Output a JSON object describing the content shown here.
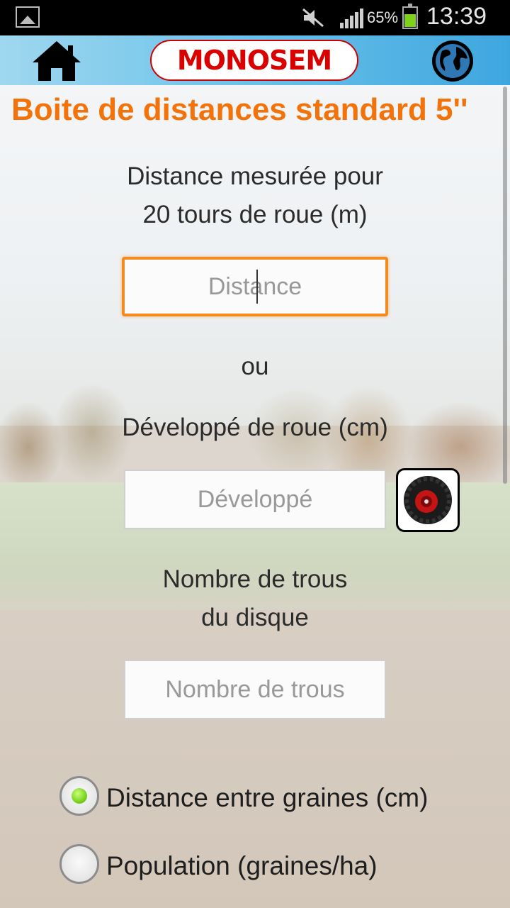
{
  "status_bar": {
    "battery_percent": "65%",
    "time": "13:39",
    "battery_level": 0.65,
    "icons": [
      "gallery-icon",
      "mute-icon",
      "signal-icon",
      "battery-icon"
    ]
  },
  "app_bar": {
    "logo_text": "MONOSEM",
    "home_icon": "home-icon",
    "globe_icon": "globe-icon",
    "brand_color": "#d90000"
  },
  "page": {
    "title": "Boite de distances standard 5''",
    "title_color": "#f3730b",
    "distance_label_line1": "Distance mesurée pour",
    "distance_label_line2": "20 tours de roue (m)",
    "distance_placeholder": "Distance",
    "or_label": "ou",
    "wheel_label": "Développé de roue (cm)",
    "wheel_placeholder": "Développé",
    "wheel_button_icon": "tire-icon",
    "holes_label_line1": "Nombre de trous",
    "holes_label_line2": "du disque",
    "holes_placeholder": "Nombre de trous"
  },
  "options": [
    {
      "label": "Distance entre graines (cm)",
      "selected": true
    },
    {
      "label": "Population (graines/ha)",
      "selected": false
    }
  ]
}
